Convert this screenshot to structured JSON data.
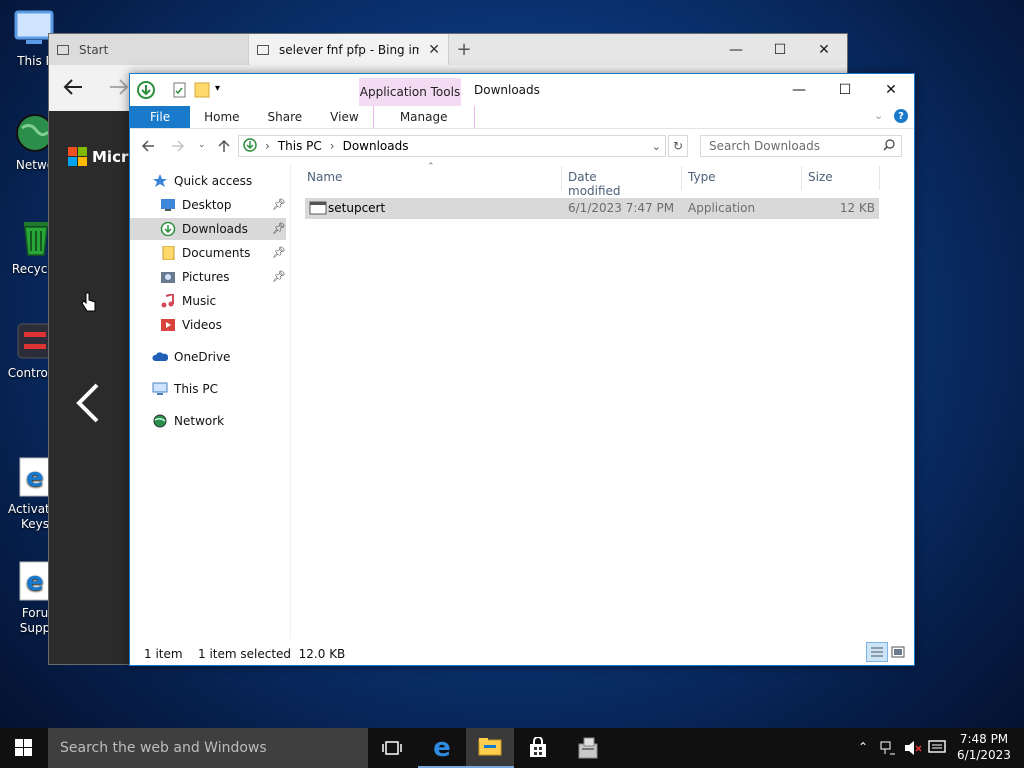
{
  "desktop": {
    "icons": [
      {
        "name": "this-pc",
        "label": "This P"
      },
      {
        "name": "network",
        "label": "Netwo"
      },
      {
        "name": "recycle-bin",
        "label": "Recycle"
      },
      {
        "name": "control-panel",
        "label": "Control P"
      },
      {
        "name": "activator-keys",
        "label": "Activator\nKeys"
      },
      {
        "name": "forum-support",
        "label": "Foru\nSupp"
      }
    ]
  },
  "browser": {
    "tabs": [
      {
        "label": "Start"
      },
      {
        "label": "selever fnf pfp - Bing ima"
      }
    ],
    "page_brand": "Micro"
  },
  "explorer": {
    "title": "Downloads",
    "context_tab": "Application Tools",
    "ribbon_tabs": [
      "File",
      "Home",
      "Share",
      "View",
      "Manage"
    ],
    "breadcrumb": [
      "This PC",
      "Downloads"
    ],
    "search_placeholder": "Search Downloads",
    "nav": {
      "quick_access": "Quick access",
      "items": [
        {
          "label": "Desktop",
          "pinned": true
        },
        {
          "label": "Downloads",
          "pinned": true
        },
        {
          "label": "Documents",
          "pinned": true
        },
        {
          "label": "Pictures",
          "pinned": true
        },
        {
          "label": "Music",
          "pinned": false
        },
        {
          "label": "Videos",
          "pinned": false
        }
      ],
      "onedrive": "OneDrive",
      "this_pc": "This PC",
      "network": "Network"
    },
    "columns": [
      "Name",
      "Date modified",
      "Type",
      "Size"
    ],
    "files": [
      {
        "name": "setupcert",
        "date": "6/1/2023 7:47 PM",
        "type": "Application",
        "size": "12 KB"
      }
    ],
    "status": {
      "count": "1 item",
      "selection": "1 item selected  12.0 KB"
    }
  },
  "taskbar": {
    "search_placeholder": "Search the web and Windows",
    "time": "7:48 PM",
    "date": "6/1/2023"
  },
  "colors": {
    "accent": "#1979ca",
    "context": "#f3dcf3",
    "selection": "#d9d9d9"
  }
}
